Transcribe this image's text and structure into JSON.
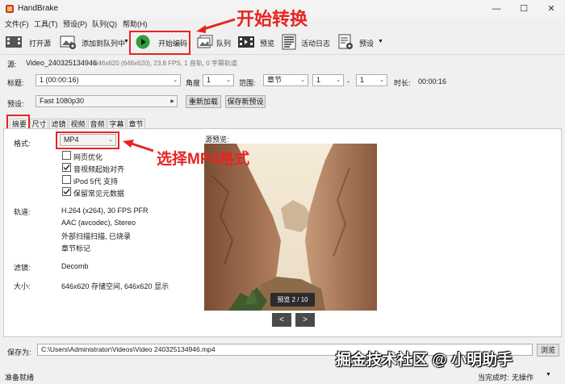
{
  "window": {
    "title": "HandBrake"
  },
  "menu": [
    "文件(F)",
    "工具(T)",
    "预设(P)",
    "队列(Q)",
    "帮助(H)"
  ],
  "toolbar": {
    "open_source": "打开源",
    "add_to_queue": "添加到队列中",
    "start_encode": "开始编码",
    "queue": "队列",
    "preview": "预览",
    "activity_log": "活动日志",
    "presets": "预设"
  },
  "source": {
    "label": "源:",
    "name": "Video_240325134946",
    "info": "646x620 (646x620), 23.8 FPS, 1 音轨, 0 字幕轨道"
  },
  "title_row": {
    "title_label": "标题:",
    "title_value": "1 (00:00:16)",
    "angle_label": "角度",
    "angle_value": "1",
    "range_label": "范围:",
    "range_mode": "章节",
    "range_start": "1",
    "range_sep": "-",
    "range_end": "1",
    "duration_label": "时长:",
    "duration_value": "00:00:16"
  },
  "preset_row": {
    "label": "预设:",
    "value": "Fast 1080p30",
    "reload": "重新加载",
    "save_new": "保存新预设"
  },
  "tabs": [
    "摘要",
    "尺寸",
    "滤镜",
    "视频",
    "音频",
    "字幕",
    "章节"
  ],
  "summary": {
    "format_label": "格式:",
    "format_value": "MP4",
    "options": [
      {
        "label": "网页优化",
        "checked": false
      },
      {
        "label": "音视频起始对齐",
        "checked": true
      },
      {
        "label": "iPod 5代 支持",
        "checked": false
      },
      {
        "label": "保留常见元数据",
        "checked": true
      }
    ],
    "tracks_label": "轨道:",
    "tracks": [
      "H.264 (x264), 30 FPS PFR",
      "AAC (avcodec), Stereo",
      "外部扫描扫描, 已烧录",
      "章节标记"
    ],
    "filters_label": "滤镜:",
    "filters_value": "Decomb",
    "size_label": "大小:",
    "size_value": "646x620 存储空间, 646x620 显示",
    "preview_label": "源预览:",
    "preview_counter": "预览 2 / 10",
    "prev_btn": "<",
    "next_btn": ">"
  },
  "save": {
    "label": "保存为:",
    "path": "C:\\Users\\Administrator\\Videos\\Video 240325134946.mp4",
    "browse": "浏览"
  },
  "status": {
    "left": "准备就绪",
    "right_label": "当完成时:",
    "right_value": "无操作"
  },
  "annotations": {
    "top": "开始转换",
    "middle": "选择MP4格式",
    "watermark": "掘金技术社区 @ 小明助手"
  },
  "colors": {
    "accent_red": "#e52521",
    "play_green": "#2e9e3e"
  }
}
